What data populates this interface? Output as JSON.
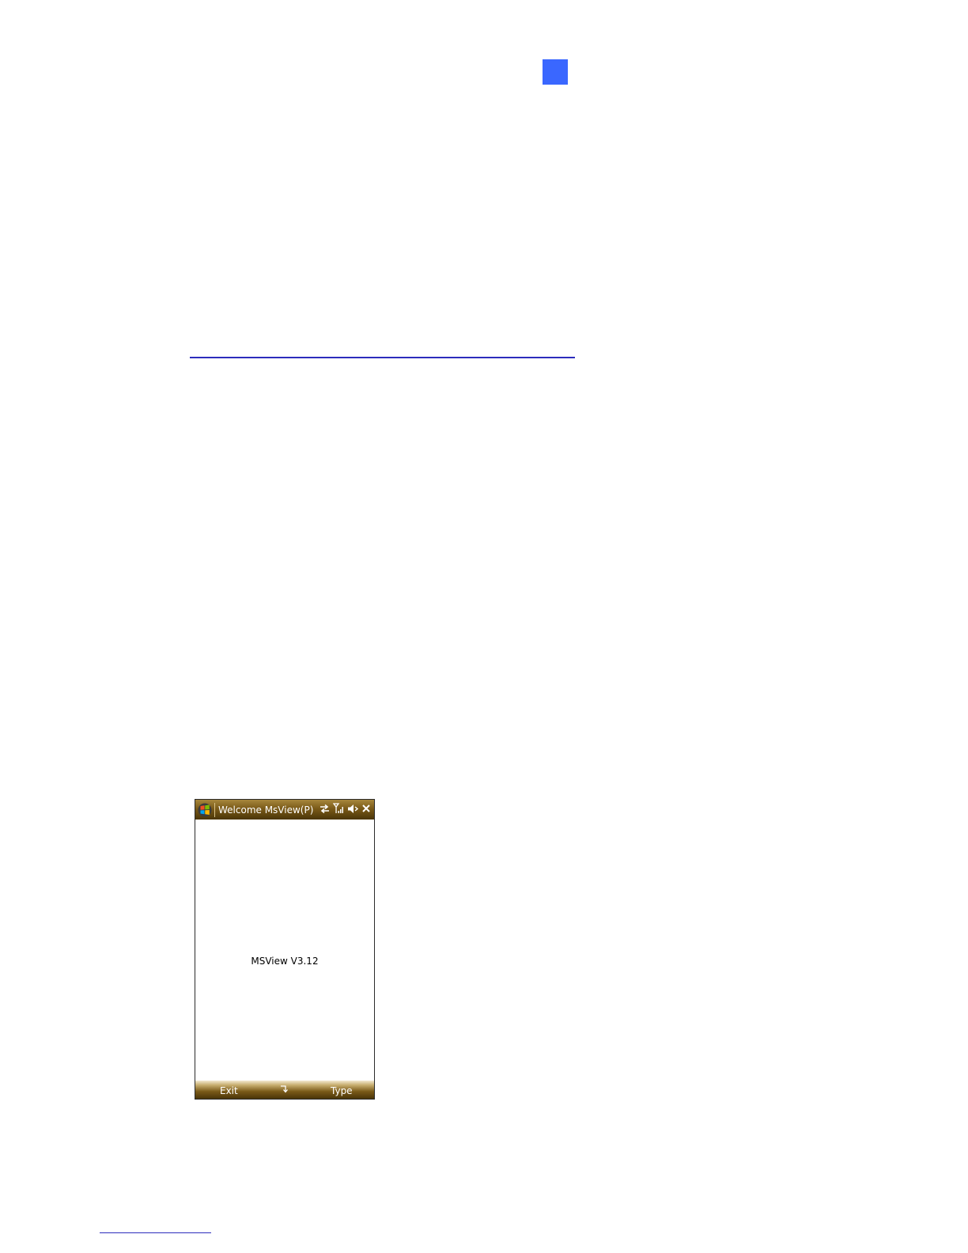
{
  "page": {
    "marker_color": "#3a67ff",
    "rule_color": "#2c2cbc"
  },
  "phone": {
    "title": "Welcome MsView(P)",
    "icons": {
      "start": "windows-start-icon",
      "connectivity": "data-connection-icon",
      "signal": "signal-strength-icon",
      "volume": "volume-muted-icon",
      "close": "close-icon"
    },
    "content": {
      "version": "MSView V3.12"
    },
    "softkeys": {
      "left": "Exit",
      "middle_icon": "back-arrow-icon",
      "right": "Type"
    },
    "theme_color": "#7a5a18"
  }
}
